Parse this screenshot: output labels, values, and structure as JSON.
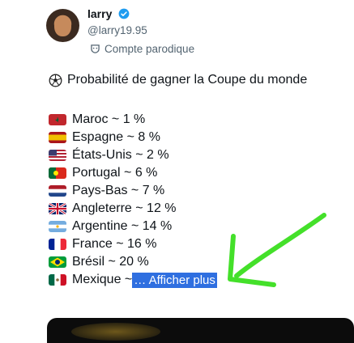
{
  "post": {
    "author_name": "larry",
    "handle": "@larry19.95",
    "parody_label": "Compte parodique",
    "headline": "Probabilité de gagner la Coupe du monde",
    "more_label": "… Afficher plus"
  },
  "teams": [
    {
      "name": "Maroc ~ 1 %",
      "flag": "morocco-flag-icon"
    },
    {
      "name": "Espagne ~ 8 %",
      "flag": "spain-flag-icon"
    },
    {
      "name": "États-Unis ~ 2 %",
      "flag": "usa-flag-icon"
    },
    {
      "name": "Portugal ~ 6 %",
      "flag": "portugal-flag-icon"
    },
    {
      "name": "Pays-Bas ~ 7 %",
      "flag": "netherlands-flag-icon"
    },
    {
      "name": "Angleterre ~ 12 %",
      "flag": "uk-flag-icon"
    },
    {
      "name": "Argentine ~ 14 %",
      "flag": "argentina-flag-icon"
    },
    {
      "name": "France ~ 16 %",
      "flag": "france-flag-icon"
    },
    {
      "name": "Brésil ~ 20 %",
      "flag": "brazil-flag-icon"
    },
    {
      "name": "Mexique ~",
      "flag": "mexico-flag-icon"
    }
  ],
  "colors": {
    "verified": "#1d9bf0",
    "secondary_text": "#536471",
    "more_highlight": "#2f6fe0",
    "annotation_arrow": "#44e02a"
  }
}
